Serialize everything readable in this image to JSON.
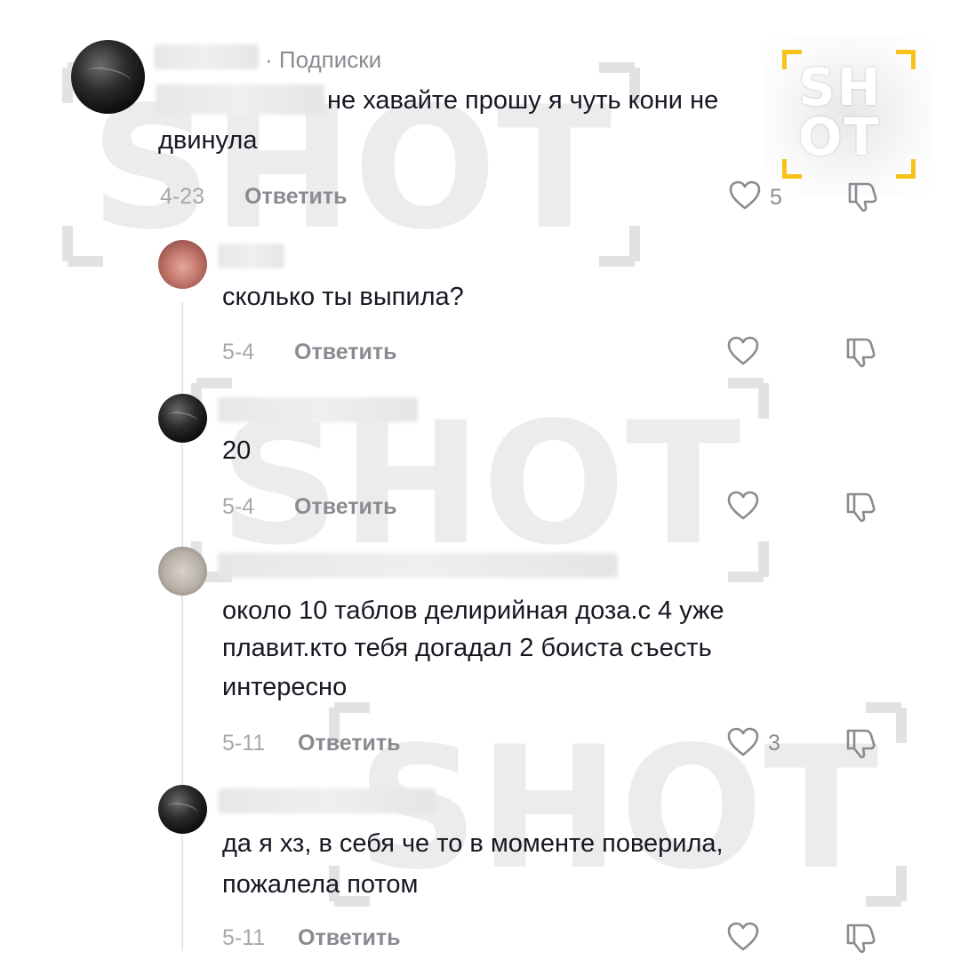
{
  "watermark": {
    "text": "SHOT"
  },
  "logo": {
    "line1": "SH",
    "line2": "OT"
  },
  "comments": [
    {
      "subscriptions_label": "· Подписки",
      "text_lines": [
        "не хавайте прошу я чуть кони не",
        "двинула"
      ],
      "date": "4-23",
      "reply_label": "Ответить",
      "like_count": "5"
    },
    {
      "text_lines": [
        "сколько ты выпила?"
      ],
      "date": "5-4",
      "reply_label": "Ответить",
      "like_count": ""
    },
    {
      "text_lines": [
        "20"
      ],
      "date": "5-4",
      "reply_label": "Ответить",
      "like_count": ""
    },
    {
      "text_lines": [
        "около 10 таблов делирийная доза.с 4 уже",
        "плавит.кто тебя догадал 2 боиста съесть",
        "интересно"
      ],
      "date": "5-11",
      "reply_label": "Ответить",
      "like_count": "3"
    },
    {
      "text_lines": [
        "да я хз, в себя че то в моменте поверила,",
        "пожалела потом"
      ],
      "date": "5-11",
      "reply_label": "Ответить",
      "like_count": ""
    }
  ],
  "icons": {
    "like": "heart-outline-icon",
    "dislike": "thumbs-down-outline-icon"
  },
  "colors": {
    "text": "#161823",
    "meta": "#8a8b91",
    "logo_accent": "#f7c21a",
    "watermark": "#dcdcdc"
  }
}
